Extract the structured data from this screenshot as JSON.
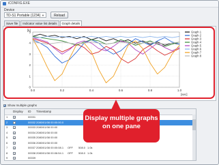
{
  "window": {
    "title": "iCONFIG.EXE"
  },
  "device": {
    "label": "Device",
    "selected": "TD-S1 Portable (1234)",
    "reload_label": "Reload"
  },
  "tabs": [
    {
      "label": "Save file"
    },
    {
      "label": "Indicator value list details"
    },
    {
      "label": "Graph details"
    }
  ],
  "chart_data": {
    "type": "line",
    "xlabel": "[sec]",
    "ylabel": "[k]",
    "xlim": [
      0,
      1.0
    ],
    "ylim": [
      0,
      5
    ],
    "xticks": [
      "0.0",
      "0.2",
      "0.4",
      "0.6",
      "0.8",
      "1.0"
    ],
    "yticks": [
      "0",
      "1",
      "2",
      "3",
      "4",
      "5"
    ],
    "grid": true,
    "legend": "right",
    "x": [
      0.0,
      0.05,
      0.1,
      0.15,
      0.2,
      0.25,
      0.3,
      0.35,
      0.4,
      0.45,
      0.5,
      0.55,
      0.6,
      0.65,
      0.7,
      0.75,
      0.8,
      0.85,
      0.9,
      0.95,
      1.0
    ],
    "series": [
      {
        "name": "Graph 1",
        "color": "#1a1a1a",
        "values": [
          4.6,
          4.8,
          4.6,
          4.7,
          4.5,
          4.6,
          4.4,
          4.6,
          4.3,
          4.5,
          4.2,
          4.4,
          4.1,
          4.3,
          4.0,
          4.2,
          3.9,
          4.1,
          3.8,
          4.0,
          3.9
        ]
      },
      {
        "name": "Graph 2",
        "color": "#2d6bd8",
        "values": [
          4.3,
          4.0,
          3.6,
          2.8,
          2.2,
          2.5,
          3.2,
          4.0,
          4.3,
          4.0,
          3.4,
          3.0,
          3.3,
          3.9,
          4.4,
          4.1,
          3.8,
          4.2,
          4.5,
          4.1,
          3.9
        ]
      },
      {
        "name": "Graph 3",
        "color": "#d82e2e",
        "values": [
          4.4,
          4.2,
          4.0,
          3.6,
          3.2,
          3.5,
          3.9,
          3.6,
          3.0,
          3.2,
          3.7,
          3.4,
          2.6,
          2.2,
          2.6,
          3.4,
          3.8,
          3.3,
          2.9,
          3.2,
          3.5
        ]
      },
      {
        "name": "Graph 4",
        "color": "#3a8c3a",
        "values": [
          4.6,
          4.5,
          4.4,
          4.3,
          4.2,
          4.0,
          3.8,
          4.1,
          4.3,
          4.2,
          3.9,
          4.0,
          4.3,
          4.1,
          3.8,
          4.0,
          4.2,
          3.9,
          3.7,
          3.9,
          4.1
        ]
      },
      {
        "name": "Graph 5",
        "color": "#b040c0",
        "values": [
          4.5,
          4.3,
          4.1,
          3.5,
          3.0,
          3.4,
          4.0,
          4.2,
          4.0,
          3.5,
          3.3,
          3.7,
          4.2,
          4.0,
          3.4,
          3.0,
          3.5,
          4.0,
          3.6,
          3.3,
          3.6
        ]
      },
      {
        "name": "Graph 6",
        "color": "#8ab4ec",
        "values": [
          4.5,
          4.5,
          4.6,
          4.5,
          4.6,
          4.5,
          4.6,
          4.5,
          4.6,
          4.5,
          4.6,
          4.5,
          4.6,
          4.5,
          4.6,
          4.5,
          4.6,
          4.5,
          4.6,
          4.5,
          4.6
        ]
      },
      {
        "name": "Graph 7",
        "color": "#f0a020",
        "values": [
          4.4,
          3.2,
          1.8,
          0.6,
          1.2,
          2.6,
          3.9,
          4.0,
          3.2,
          1.6,
          0.4,
          1.0,
          2.4,
          3.8,
          4.2,
          3.5,
          2.2,
          1.2,
          1.8,
          3.0,
          3.8
        ]
      },
      {
        "name": "Graph 8",
        "color": "#b8b8b8",
        "values": [
          4.1,
          4.0,
          3.9,
          4.0,
          4.1,
          4.0,
          3.9,
          4.0,
          4.1,
          4.0,
          3.9,
          4.0,
          4.1,
          4.0,
          3.9,
          4.0,
          4.1,
          4.0,
          3.9,
          4.0,
          4.1
        ]
      }
    ]
  },
  "show_multiple": {
    "label": "Show multiple graphs",
    "checked": true
  },
  "table": {
    "headers": [
      "Display",
      "ID",
      "Timestamp"
    ],
    "rows": [
      {
        "num": "1",
        "checked": true,
        "id": "00031",
        "time": "",
        "state": "",
        "value": "",
        "unit": "",
        "selected": false
      },
      {
        "num": "2",
        "checked": true,
        "id": "00032",
        "time": "2080/01/08 00:00:00.0",
        "state": "",
        "value": "",
        "unit": "",
        "selected": true
      },
      {
        "num": "3",
        "checked": true,
        "id": "00033",
        "time": "2080/01/08 00:00",
        "state": "",
        "value": "",
        "unit": "",
        "selected": false
      },
      {
        "num": "4",
        "checked": true,
        "id": "00034",
        "time": "2080/01/08 00:00",
        "state": "",
        "value": "",
        "unit": "",
        "selected": false
      },
      {
        "num": "5",
        "checked": true,
        "id": "00035",
        "time": "2080/01/08 00:00",
        "state": "",
        "value": "",
        "unit": "",
        "selected": false
      },
      {
        "num": "6",
        "checked": true,
        "id": "00036",
        "time": "2080/01/08 00:00",
        "state": "",
        "value": "",
        "unit": "",
        "selected": false
      },
      {
        "num": "7",
        "checked": true,
        "id": "00037",
        "time": "2080/01/08 00:00:08.1",
        "state": "OFF",
        "value": "508.0",
        "unit": "1.0k",
        "selected": false
      },
      {
        "num": "8",
        "checked": true,
        "id": "00038",
        "time": "2080/01/08 00:06:54.1",
        "state": "OFF",
        "value": "508.0",
        "unit": "1.0k",
        "selected": false
      },
      {
        "num": "9",
        "checked": true,
        "id": "00039",
        "time": "",
        "state": "",
        "value": "",
        "unit": "",
        "selected": false
      }
    ]
  },
  "callout": {
    "text": "Display multiple graphs on one pane",
    "color": "#e0202c"
  }
}
